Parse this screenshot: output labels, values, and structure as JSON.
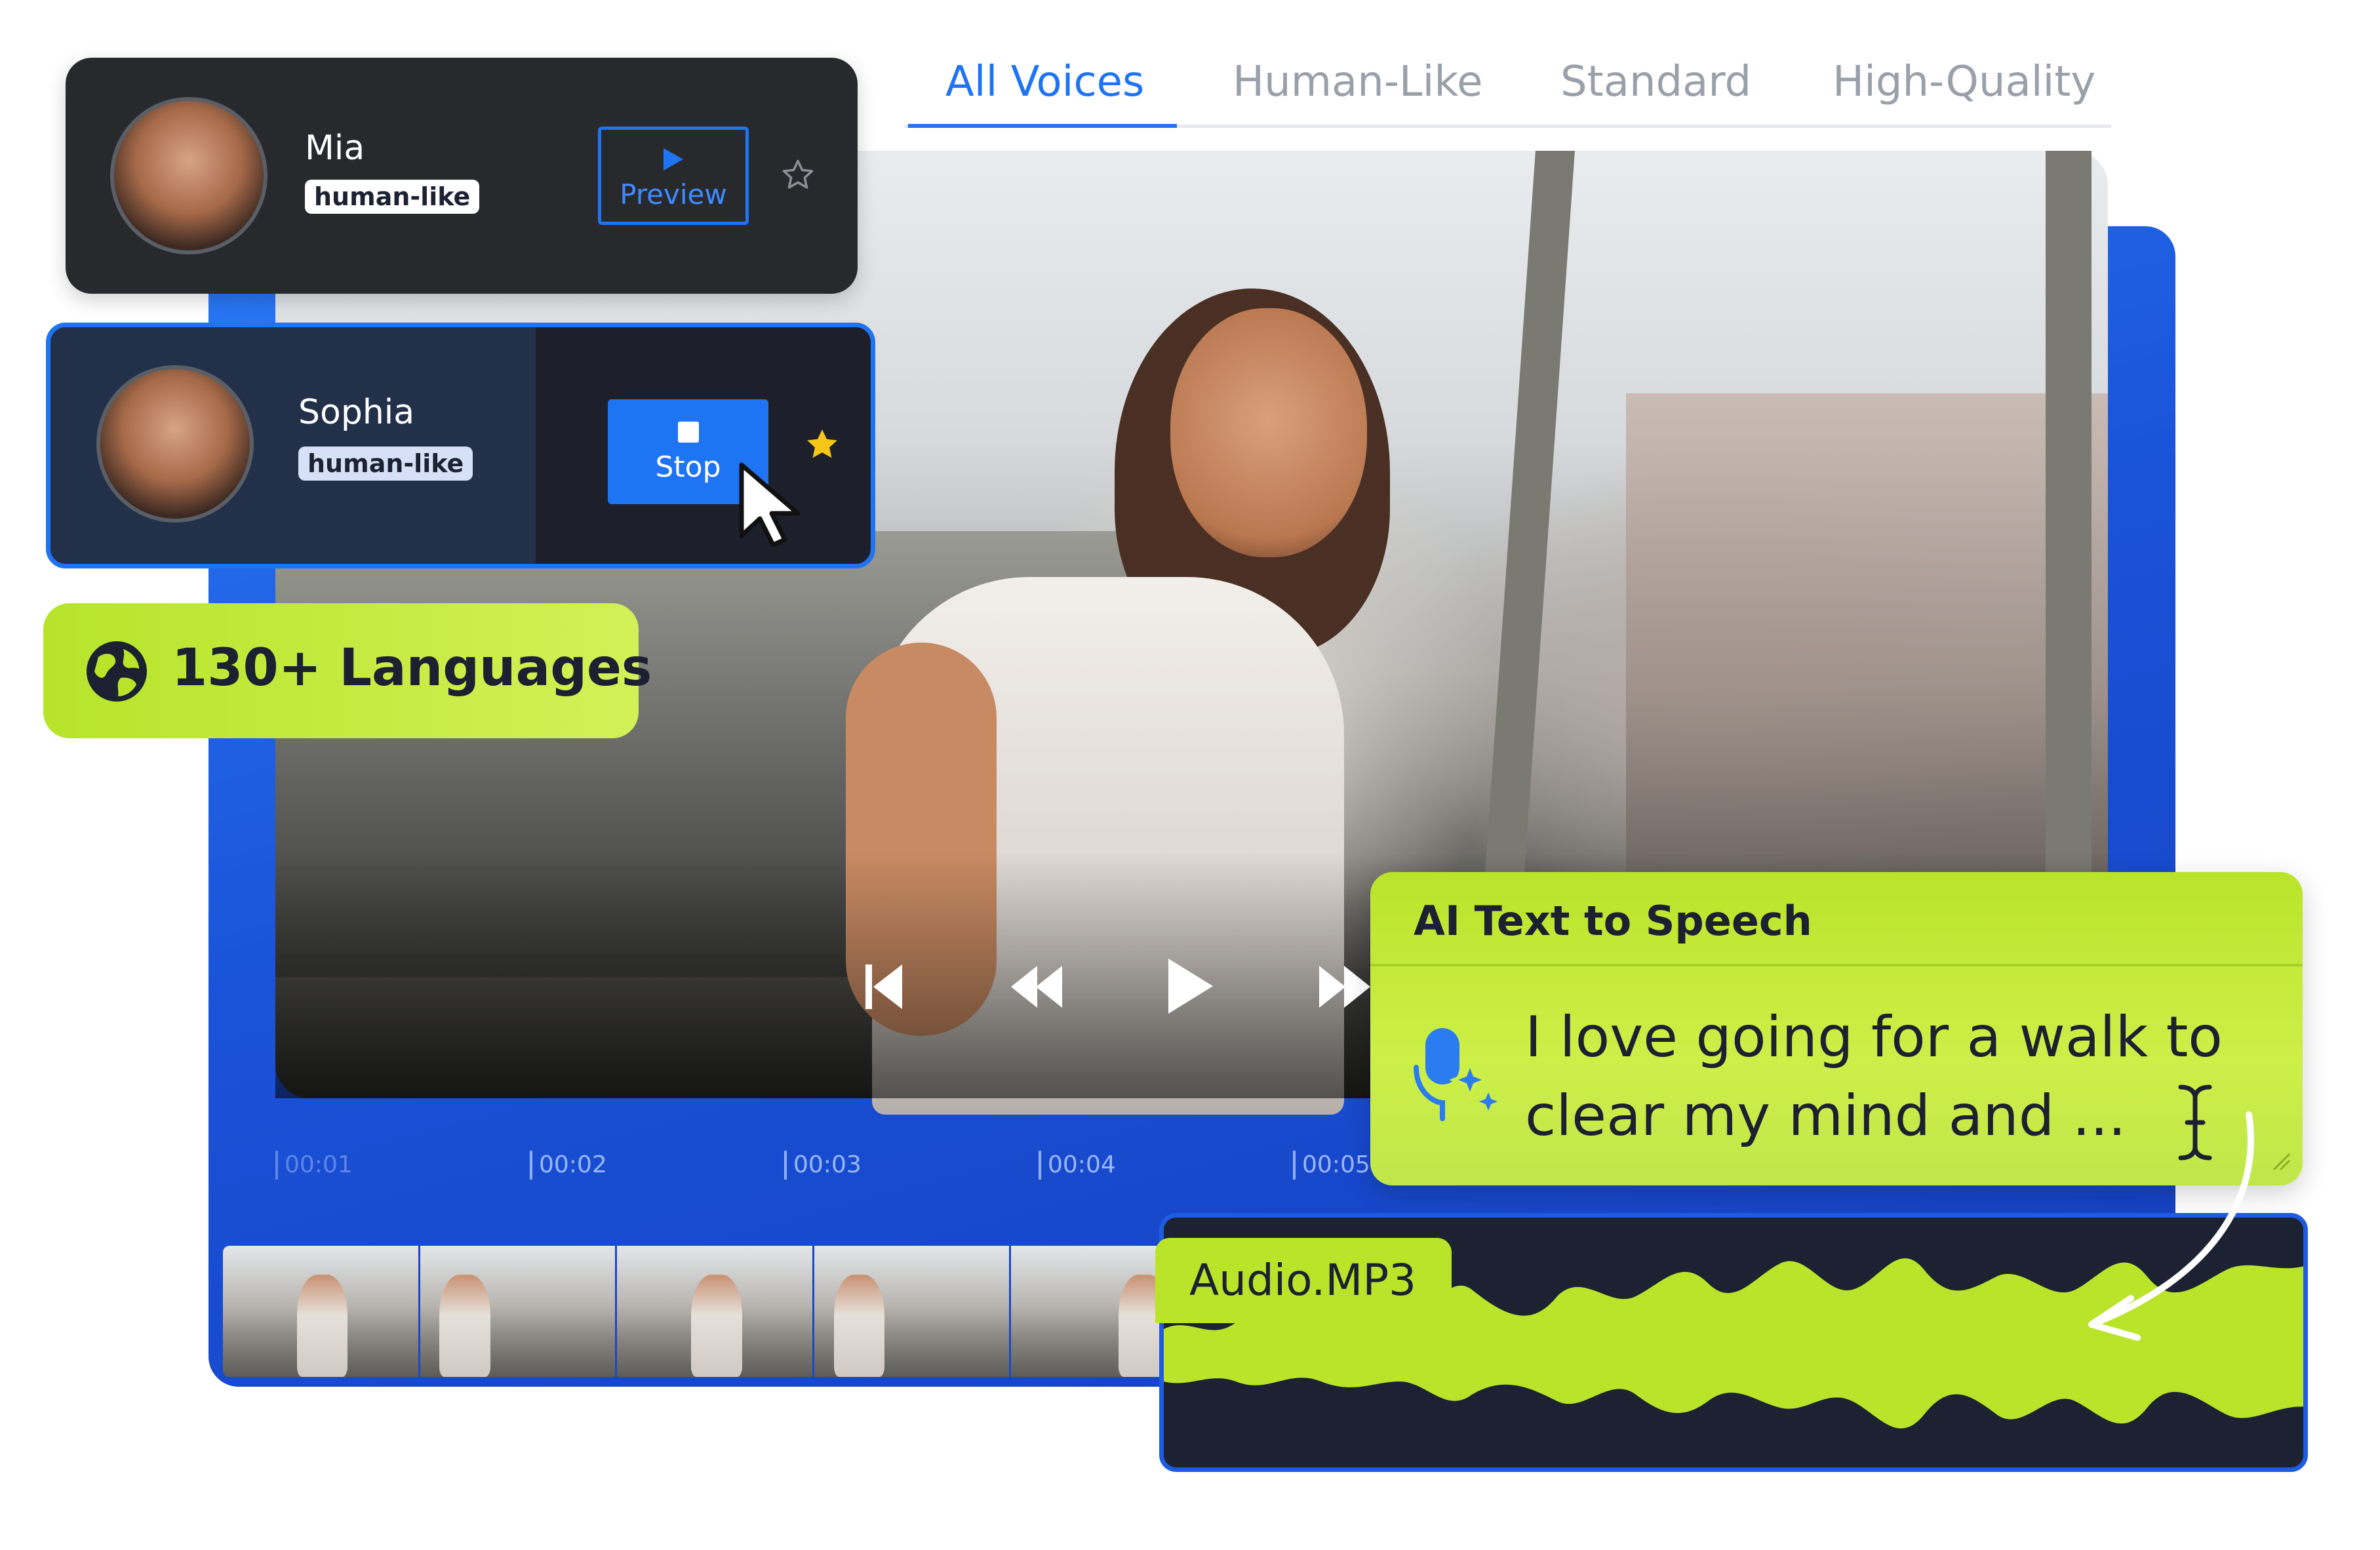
{
  "tabs": [
    {
      "label": "All Voices",
      "active": true
    },
    {
      "label": "Human-Like",
      "active": false
    },
    {
      "label": "Standard",
      "active": false
    },
    {
      "label": "High-Quality",
      "active": false
    }
  ],
  "voices": [
    {
      "name": "Mia",
      "tag": "human-like",
      "button_label": "Preview",
      "button_icon": "play-icon",
      "favorite": false,
      "selected": false
    },
    {
      "name": "Sophia",
      "tag": "human-like",
      "button_label": "Stop",
      "button_icon": "stop-icon",
      "favorite": true,
      "selected": true
    }
  ],
  "languages": {
    "label": "130+ Languages",
    "icon": "globe-icon"
  },
  "player": {
    "controls": [
      "skip-back-icon",
      "rewind-icon",
      "play-icon",
      "fast-forward-icon"
    ]
  },
  "timeline": {
    "ticks": [
      "00:01",
      "00:02",
      "00:03",
      "00:04",
      "00:05"
    ]
  },
  "tts": {
    "title": "AI Text to Speech",
    "text": "I love going for a walk to clear my mind and ...",
    "icon": "ai-microphone-icon"
  },
  "audio": {
    "file_label": "Audio.MP3"
  },
  "colors": {
    "accent_blue": "#1e74f2",
    "lime": "#b9e42a",
    "dark_card": "#28292d"
  }
}
